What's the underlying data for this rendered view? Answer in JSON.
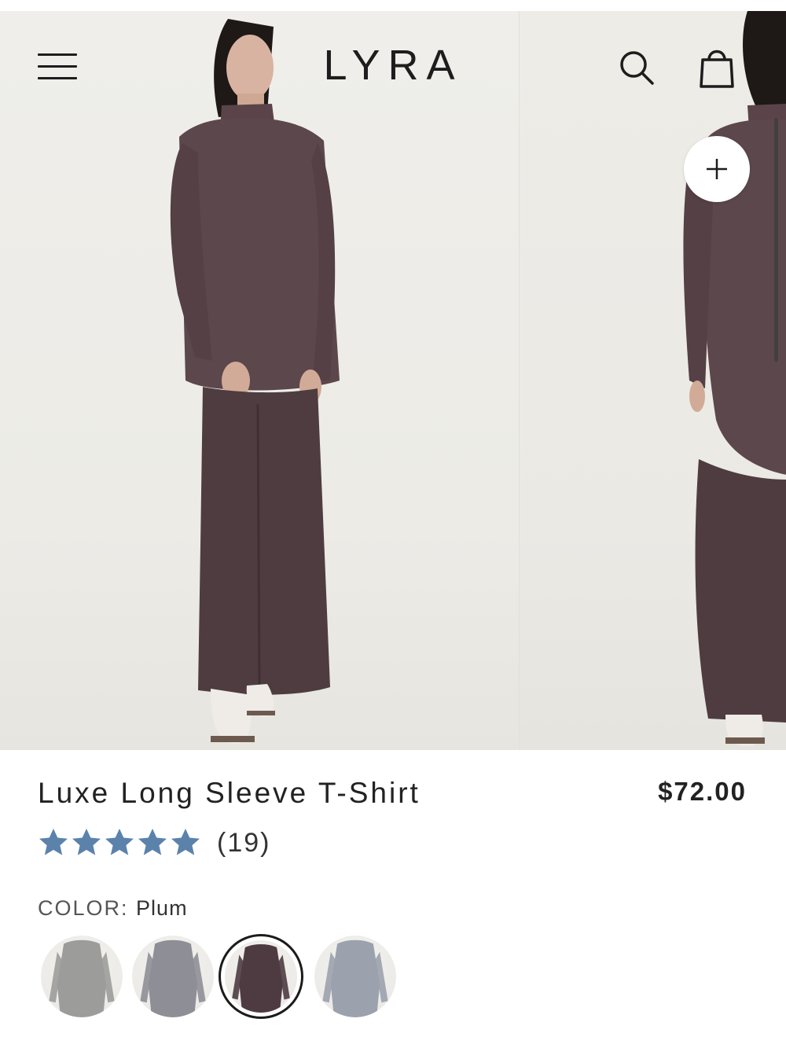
{
  "brand": {
    "logo": "LYRA"
  },
  "header": {
    "menu_icon": "hamburger-menu-icon",
    "search_icon": "search-icon",
    "bag_icon": "shopping-bag-icon"
  },
  "gallery": {
    "add_icon": "plus-icon"
  },
  "product": {
    "title": "Luxe Long Sleeve T-Shirt",
    "price": "$72.00",
    "rating": {
      "stars": 5,
      "max": 5,
      "review_count": "(19)",
      "star_color": "#5b82ab"
    },
    "color_label": "COLOR:",
    "color_value": "Plum",
    "selected_color": "#4e3b42"
  },
  "swatches": [
    {
      "selected": false,
      "tone": "#9c9c9a"
    },
    {
      "selected": false,
      "tone": "#8e8f96"
    },
    {
      "selected": true,
      "tone": "#4e3b42"
    },
    {
      "selected": false,
      "tone": "#9ba1ad"
    }
  ]
}
